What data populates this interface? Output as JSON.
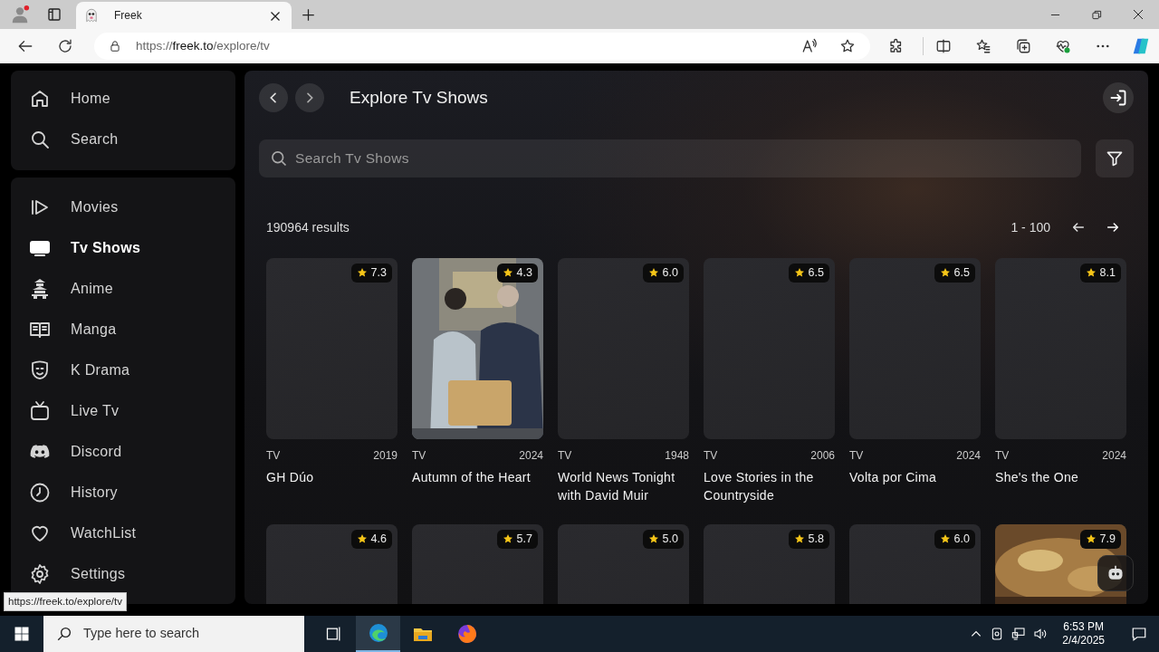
{
  "browser": {
    "tab_title": "Freek",
    "url": {
      "scheme": "https://",
      "host": "freek.to",
      "path": "/explore/tv"
    },
    "status_link": "https://freek.to/explore/tv"
  },
  "sidebar": {
    "groups": [
      {
        "items": [
          {
            "label": "Home",
            "kind": "home",
            "selected": false
          },
          {
            "label": "Search",
            "kind": "search",
            "selected": false
          }
        ]
      },
      {
        "items": [
          {
            "label": "Movies",
            "kind": "movies",
            "selected": false
          },
          {
            "label": "Tv Shows",
            "kind": "tv",
            "selected": true
          },
          {
            "label": "Anime",
            "kind": "anime",
            "selected": false
          },
          {
            "label": "Manga",
            "kind": "manga",
            "selected": false
          },
          {
            "label": "K Drama",
            "kind": "kdrama",
            "selected": false
          },
          {
            "label": "Live Tv",
            "kind": "livetv",
            "selected": false
          },
          {
            "label": "Discord",
            "kind": "discord",
            "selected": false
          },
          {
            "label": "History",
            "kind": "history",
            "selected": false
          },
          {
            "label": "WatchList",
            "kind": "watchlist",
            "selected": false
          },
          {
            "label": "Settings",
            "kind": "settings",
            "selected": false
          }
        ]
      }
    ]
  },
  "header": {
    "title": "Explore Tv Shows"
  },
  "search": {
    "placeholder": "Search Tv Shows"
  },
  "results": {
    "count": "190964 results",
    "range": "1 - 100"
  },
  "cards": [
    {
      "rating": "7.3",
      "type": "TV",
      "year": "2019",
      "title": "GH Dúo",
      "kind": "blank"
    },
    {
      "rating": "4.3",
      "type": "TV",
      "year": "2024",
      "title": "Autumn of the Heart",
      "kind": "picture"
    },
    {
      "rating": "6.0",
      "type": "TV",
      "year": "1948",
      "title": "World News Tonight with David Muir",
      "kind": "blank"
    },
    {
      "rating": "6.5",
      "type": "TV",
      "year": "2006",
      "title": "Love Stories in the Countryside",
      "kind": "blank"
    },
    {
      "rating": "6.5",
      "type": "TV",
      "year": "2024",
      "title": "Volta por Cima",
      "kind": "blank"
    },
    {
      "rating": "8.1",
      "type": "TV",
      "year": "2024",
      "title": "She's the One",
      "kind": "blank"
    },
    {
      "rating": "4.6",
      "kind": "blank"
    },
    {
      "rating": "5.7",
      "kind": "blank"
    },
    {
      "rating": "5.0",
      "kind": "blank"
    },
    {
      "rating": "5.8",
      "kind": "blank"
    },
    {
      "rating": "6.0",
      "kind": "blank"
    },
    {
      "rating": "7.9",
      "kind": "picture"
    }
  ],
  "taskbar": {
    "search_placeholder": "Type here to search",
    "time": "6:53 PM",
    "date": "2/4/2025"
  }
}
